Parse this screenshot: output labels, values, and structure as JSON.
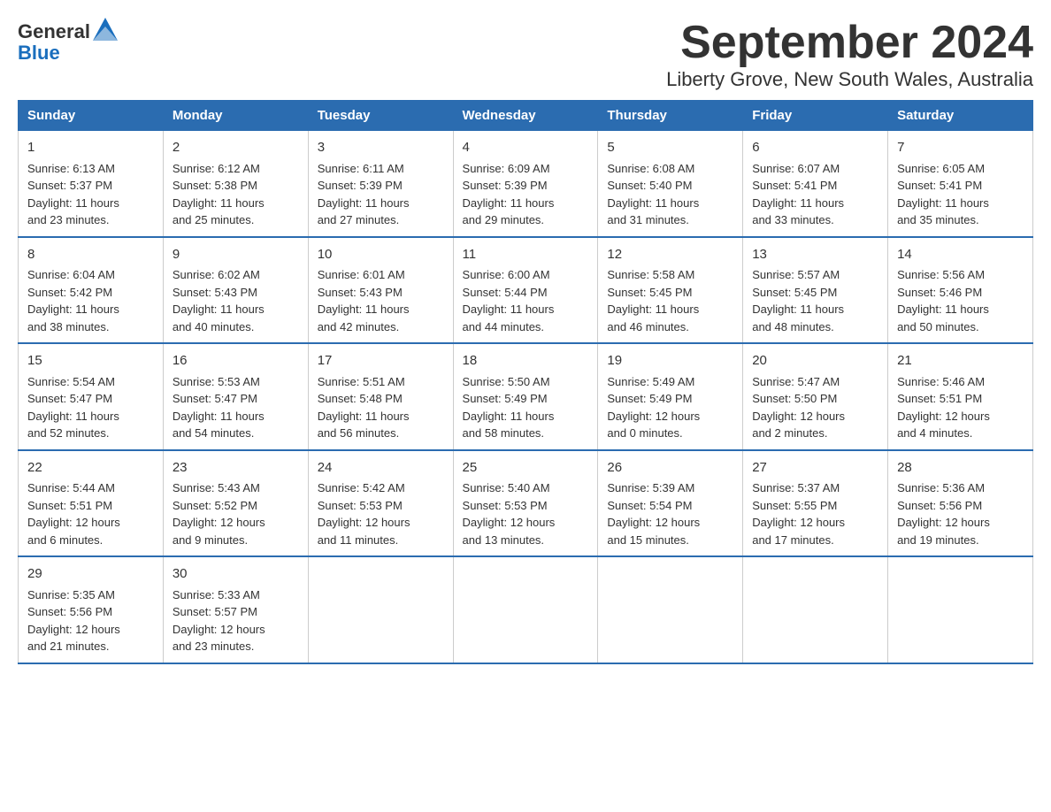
{
  "header": {
    "logo_text_general": "General",
    "logo_text_blue": "Blue",
    "title": "September 2024",
    "subtitle": "Liberty Grove, New South Wales, Australia"
  },
  "weekdays": [
    "Sunday",
    "Monday",
    "Tuesday",
    "Wednesday",
    "Thursday",
    "Friday",
    "Saturday"
  ],
  "weeks": [
    [
      {
        "day": "1",
        "sunrise": "6:13 AM",
        "sunset": "5:37 PM",
        "daylight": "11 hours and 23 minutes."
      },
      {
        "day": "2",
        "sunrise": "6:12 AM",
        "sunset": "5:38 PM",
        "daylight": "11 hours and 25 minutes."
      },
      {
        "day": "3",
        "sunrise": "6:11 AM",
        "sunset": "5:39 PM",
        "daylight": "11 hours and 27 minutes."
      },
      {
        "day": "4",
        "sunrise": "6:09 AM",
        "sunset": "5:39 PM",
        "daylight": "11 hours and 29 minutes."
      },
      {
        "day": "5",
        "sunrise": "6:08 AM",
        "sunset": "5:40 PM",
        "daylight": "11 hours and 31 minutes."
      },
      {
        "day": "6",
        "sunrise": "6:07 AM",
        "sunset": "5:41 PM",
        "daylight": "11 hours and 33 minutes."
      },
      {
        "day": "7",
        "sunrise": "6:05 AM",
        "sunset": "5:41 PM",
        "daylight": "11 hours and 35 minutes."
      }
    ],
    [
      {
        "day": "8",
        "sunrise": "6:04 AM",
        "sunset": "5:42 PM",
        "daylight": "11 hours and 38 minutes."
      },
      {
        "day": "9",
        "sunrise": "6:02 AM",
        "sunset": "5:43 PM",
        "daylight": "11 hours and 40 minutes."
      },
      {
        "day": "10",
        "sunrise": "6:01 AM",
        "sunset": "5:43 PM",
        "daylight": "11 hours and 42 minutes."
      },
      {
        "day": "11",
        "sunrise": "6:00 AM",
        "sunset": "5:44 PM",
        "daylight": "11 hours and 44 minutes."
      },
      {
        "day": "12",
        "sunrise": "5:58 AM",
        "sunset": "5:45 PM",
        "daylight": "11 hours and 46 minutes."
      },
      {
        "day": "13",
        "sunrise": "5:57 AM",
        "sunset": "5:45 PM",
        "daylight": "11 hours and 48 minutes."
      },
      {
        "day": "14",
        "sunrise": "5:56 AM",
        "sunset": "5:46 PM",
        "daylight": "11 hours and 50 minutes."
      }
    ],
    [
      {
        "day": "15",
        "sunrise": "5:54 AM",
        "sunset": "5:47 PM",
        "daylight": "11 hours and 52 minutes."
      },
      {
        "day": "16",
        "sunrise": "5:53 AM",
        "sunset": "5:47 PM",
        "daylight": "11 hours and 54 minutes."
      },
      {
        "day": "17",
        "sunrise": "5:51 AM",
        "sunset": "5:48 PM",
        "daylight": "11 hours and 56 minutes."
      },
      {
        "day": "18",
        "sunrise": "5:50 AM",
        "sunset": "5:49 PM",
        "daylight": "11 hours and 58 minutes."
      },
      {
        "day": "19",
        "sunrise": "5:49 AM",
        "sunset": "5:49 PM",
        "daylight": "12 hours and 0 minutes."
      },
      {
        "day": "20",
        "sunrise": "5:47 AM",
        "sunset": "5:50 PM",
        "daylight": "12 hours and 2 minutes."
      },
      {
        "day": "21",
        "sunrise": "5:46 AM",
        "sunset": "5:51 PM",
        "daylight": "12 hours and 4 minutes."
      }
    ],
    [
      {
        "day": "22",
        "sunrise": "5:44 AM",
        "sunset": "5:51 PM",
        "daylight": "12 hours and 6 minutes."
      },
      {
        "day": "23",
        "sunrise": "5:43 AM",
        "sunset": "5:52 PM",
        "daylight": "12 hours and 9 minutes."
      },
      {
        "day": "24",
        "sunrise": "5:42 AM",
        "sunset": "5:53 PM",
        "daylight": "12 hours and 11 minutes."
      },
      {
        "day": "25",
        "sunrise": "5:40 AM",
        "sunset": "5:53 PM",
        "daylight": "12 hours and 13 minutes."
      },
      {
        "day": "26",
        "sunrise": "5:39 AM",
        "sunset": "5:54 PM",
        "daylight": "12 hours and 15 minutes."
      },
      {
        "day": "27",
        "sunrise": "5:37 AM",
        "sunset": "5:55 PM",
        "daylight": "12 hours and 17 minutes."
      },
      {
        "day": "28",
        "sunrise": "5:36 AM",
        "sunset": "5:56 PM",
        "daylight": "12 hours and 19 minutes."
      }
    ],
    [
      {
        "day": "29",
        "sunrise": "5:35 AM",
        "sunset": "5:56 PM",
        "daylight": "12 hours and 21 minutes."
      },
      {
        "day": "30",
        "sunrise": "5:33 AM",
        "sunset": "5:57 PM",
        "daylight": "12 hours and 23 minutes."
      },
      null,
      null,
      null,
      null,
      null
    ]
  ],
  "labels": {
    "sunrise": "Sunrise:",
    "sunset": "Sunset:",
    "daylight": "Daylight:"
  }
}
